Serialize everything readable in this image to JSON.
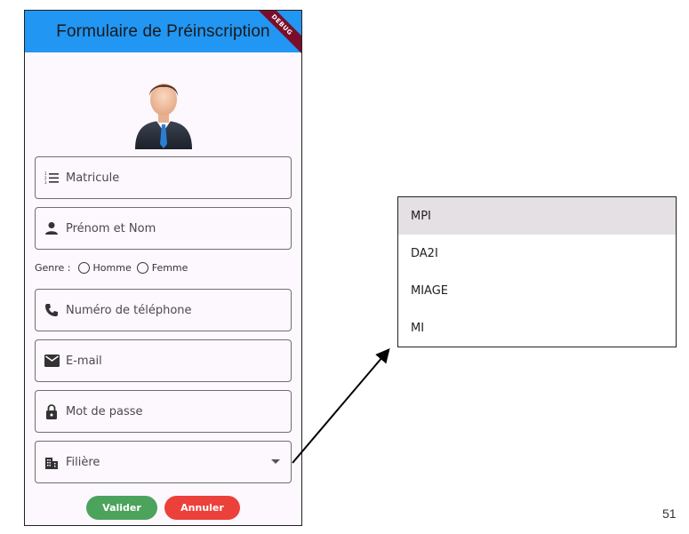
{
  "app": {
    "title": "Formulaire de Préinscription",
    "debug_banner": "DEBUG"
  },
  "form": {
    "fields": [
      {
        "label": "Matricule",
        "icon": "numbered-list-icon"
      },
      {
        "label": "Prénom et Nom",
        "icon": "person-icon"
      },
      {
        "label": "Numéro de téléphone",
        "icon": "phone-icon"
      },
      {
        "label": "E-mail",
        "icon": "mail-icon"
      },
      {
        "label": "Mot de passe",
        "icon": "lock-icon"
      },
      {
        "label": "Filière",
        "icon": "building-icon"
      }
    ],
    "genre": {
      "label": "Genre :",
      "options": [
        "Homme",
        "Femme"
      ]
    },
    "buttons": {
      "submit": "Valider",
      "cancel": "Annuler"
    }
  },
  "dropdown": {
    "options": [
      "MPI",
      "DA2I",
      "MIAGE",
      "MI"
    ],
    "highlighted": "MPI"
  },
  "page_number": "51",
  "colors": {
    "appbar": "#2196f3",
    "submit": "#4ca35c",
    "cancel": "#ec403a",
    "debug": "#7a0e2a"
  }
}
